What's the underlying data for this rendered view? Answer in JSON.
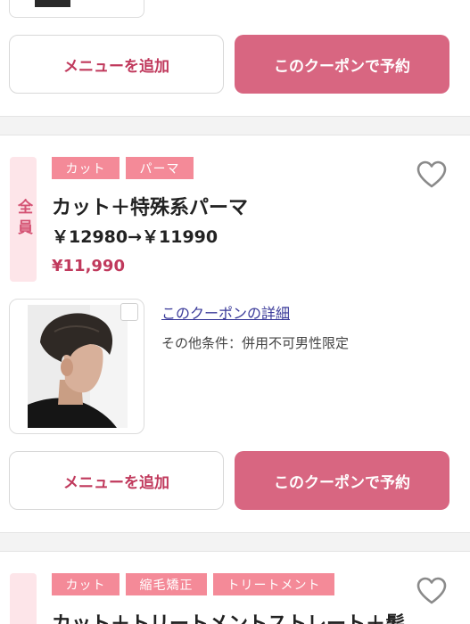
{
  "colors": {
    "accent": "#d86681",
    "accent_text": "#c0395c",
    "tag_bg": "#f48a98",
    "badge_bg": "#fde5e9"
  },
  "prev_card": {
    "add_menu_label": "メニューを追加",
    "reserve_label": "このクーポンで予約"
  },
  "coupons": [
    {
      "badge": "全員",
      "tags": [
        "カット",
        "パーマ"
      ],
      "title": "カット＋特殊系パーマ",
      "subprice": "￥12980→￥11990",
      "price": "¥11,990",
      "detail_link": "このクーポンの詳細",
      "condition": "その他条件：併用不可男性限定",
      "add_menu_label": "メニューを追加",
      "reserve_label": "このクーポンで予約",
      "favorite_icon": "heart-outline-icon"
    },
    {
      "tags": [
        "カット",
        "縮毛矯正",
        "トリートメント"
      ],
      "title": "カット＋トリートメントストレート＋髪",
      "favorite_icon": "heart-outline-icon"
    }
  ]
}
